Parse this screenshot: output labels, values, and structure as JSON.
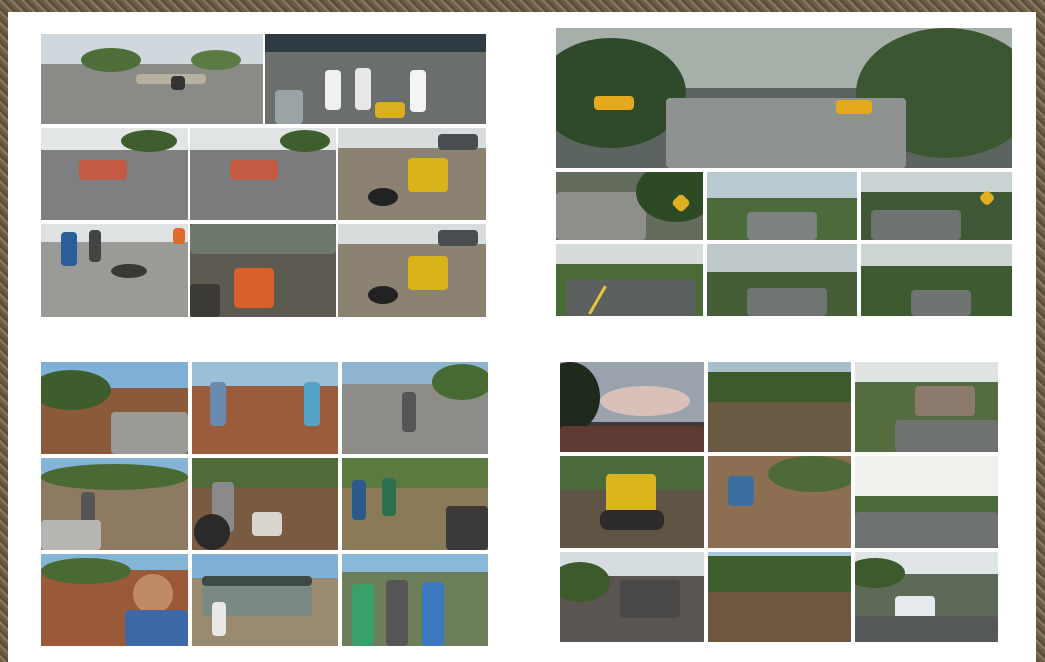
{
  "image": {
    "description_name": "road-works-photo-collage-sheet",
    "background_colors": {
      "frame": "#7a6a52",
      "sheet": "#ffffff"
    },
    "collages": [
      {
        "name": "collage-street-pothole-repair",
        "photos": 8
      },
      {
        "name": "collage-paved-mountain-road",
        "photos": 7
      },
      {
        "name": "collage-rural-road-construction-workers",
        "photos": 9
      },
      {
        "name": "collage-road-grading-and-paving",
        "photos": 9
      }
    ]
  }
}
